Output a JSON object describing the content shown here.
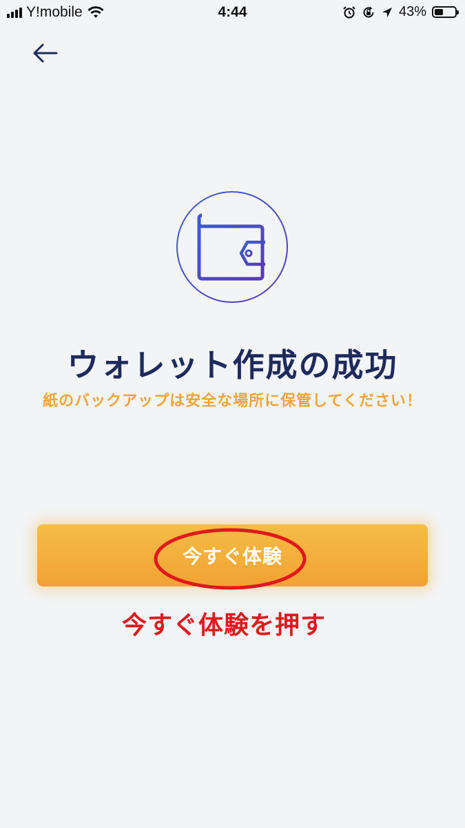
{
  "status_bar": {
    "carrier": "Y!mobile",
    "time": "4:44",
    "battery_percent_label": "43%",
    "battery_level": 0.43,
    "icons": [
      "signal-icon",
      "wifi-icon",
      "alarm-icon",
      "rotation-lock-icon",
      "location-icon",
      "battery-icon"
    ]
  },
  "nav": {
    "back_icon": "arrow-left-icon"
  },
  "hero": {
    "icon": "wallet-icon",
    "title": "ウォレット作成の成功",
    "subtitle": "紙のバックアップは安全な場所に保管してください！"
  },
  "cta": {
    "label": "今すぐ体験"
  },
  "annotation": {
    "text": "今すぐ体験を押す"
  },
  "colors": {
    "background": "#f3f4f6",
    "title": "#1f2a5c",
    "subtitle": "#f0a43a",
    "button_top": "#f5bd45",
    "button_bottom": "#f2a233",
    "annotation": "#e0191e",
    "icon_gradient_start": "#3a5fc9",
    "icon_gradient_end": "#5a3ab0"
  }
}
